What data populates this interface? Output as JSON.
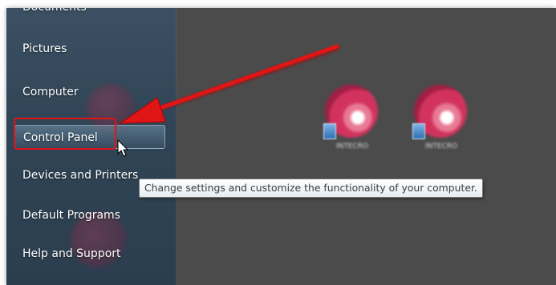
{
  "start_menu": {
    "items": [
      {
        "label": "Documents"
      },
      {
        "label": "Pictures"
      },
      {
        "label": "Computer"
      },
      {
        "label": "Control Panel"
      },
      {
        "label": "Devices and Printers"
      },
      {
        "label": "Default Programs"
      },
      {
        "label": "Help and Support"
      }
    ]
  },
  "tooltip": {
    "text": "Change settings and customize the functionality of your computer."
  },
  "desktop": {
    "icons": [
      {
        "label": "INTECRO",
        "icon": "app-disc-icon"
      },
      {
        "label": "INTECRO",
        "icon": "app-disc-icon"
      }
    ]
  },
  "annotation": {
    "color": "#e01515",
    "highlight_target": "Control Panel"
  }
}
